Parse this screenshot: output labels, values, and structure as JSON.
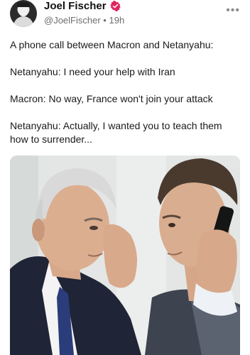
{
  "post": {
    "author_name": "Joel Fischer",
    "handle": "@JoelFischer",
    "separator": "•",
    "timestamp": "19h",
    "more_icon": "more-horizontal-icon",
    "verified_color": "#e0245e"
  },
  "content": {
    "lines": [
      "A phone call between Macron and Netanyahu:",
      "Netanyahu: I need your help with Iran",
      "Macron: No way, France won't join your attack",
      "Netanyahu: Actually, I wanted you to teach them how to surrender..."
    ]
  },
  "media": {
    "alt_icon": "photo-image"
  }
}
